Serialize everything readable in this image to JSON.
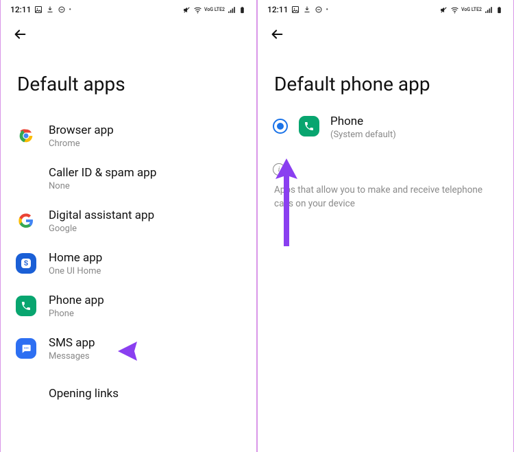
{
  "status": {
    "time": "12:11",
    "lte_label": "VoG LTE2"
  },
  "left": {
    "title": "Default apps",
    "items": [
      {
        "title": "Browser app",
        "sub": "Chrome",
        "icon": "chrome"
      },
      {
        "title": "Caller ID & spam app",
        "sub": "None",
        "icon": "none"
      },
      {
        "title": "Digital assistant app",
        "sub": "Google",
        "icon": "google"
      },
      {
        "title": "Home app",
        "sub": "One UI Home",
        "icon": "home"
      },
      {
        "title": "Phone app",
        "sub": "Phone",
        "icon": "phone"
      },
      {
        "title": "SMS app",
        "sub": "Messages",
        "icon": "sms"
      },
      {
        "title": "Opening links",
        "sub": "",
        "icon": "none"
      }
    ]
  },
  "right": {
    "title": "Default phone app",
    "option": {
      "title": "Phone",
      "sub": "(System default)"
    },
    "info": "Apps that allow you to make and receive telephone calls on your device"
  }
}
